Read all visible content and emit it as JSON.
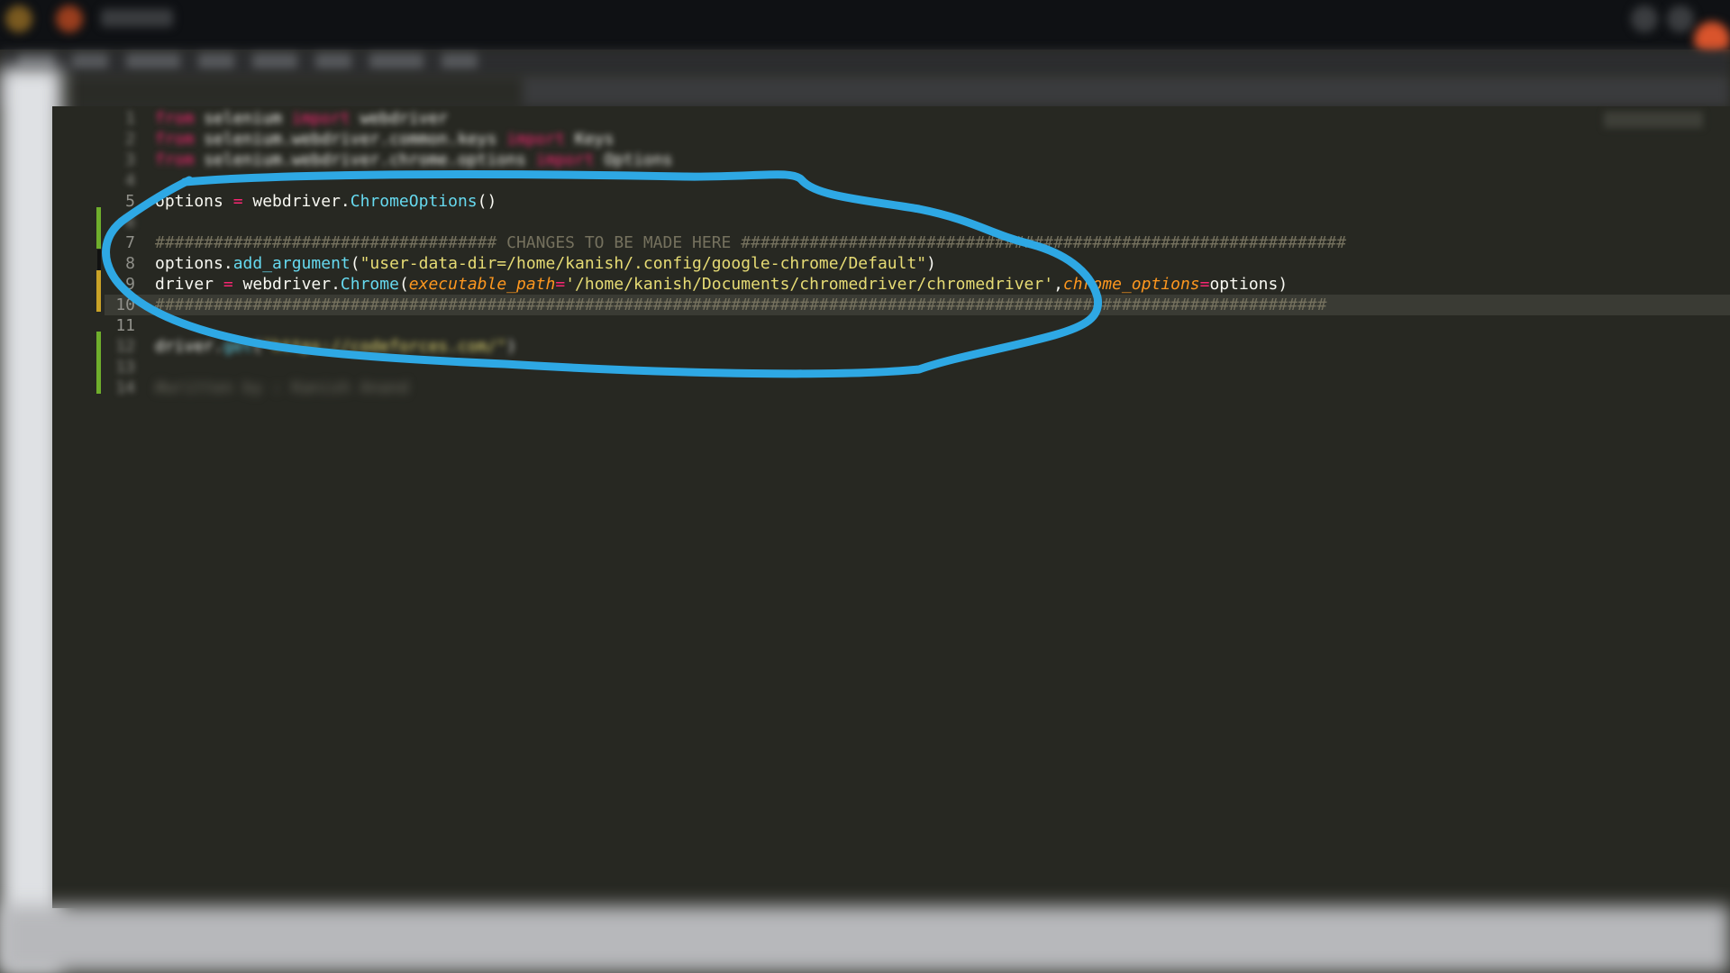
{
  "window": {
    "title": ""
  },
  "editor": {
    "current_line": "10",
    "lines": [
      {
        "num": "1",
        "tokens": [
          {
            "t": "from",
            "c": "kw"
          },
          {
            "t": " selenium ",
            "c": "txt"
          },
          {
            "t": "import",
            "c": "kw"
          },
          {
            "t": " webdriver",
            "c": "txt"
          }
        ]
      },
      {
        "num": "2",
        "tokens": [
          {
            "t": "from",
            "c": "kw"
          },
          {
            "t": " selenium.webdriver.common.keys ",
            "c": "txt"
          },
          {
            "t": "import",
            "c": "kw"
          },
          {
            "t": " Keys",
            "c": "txt"
          }
        ]
      },
      {
        "num": "3",
        "tokens": [
          {
            "t": "from",
            "c": "kw"
          },
          {
            "t": " selenium.webdriver.chrome.options ",
            "c": "txt"
          },
          {
            "t": "import",
            "c": "kw"
          },
          {
            "t": " Options",
            "c": "txt"
          }
        ]
      },
      {
        "num": "4",
        "tokens": []
      },
      {
        "num": "5",
        "tokens": [
          {
            "t": "options",
            "c": "txt"
          },
          {
            "t": " = ",
            "c": "op"
          },
          {
            "t": "webdriver.",
            "c": "txt"
          },
          {
            "t": "ChromeOptions",
            "c": "fn"
          },
          {
            "t": "()",
            "c": "txt"
          }
        ]
      },
      {
        "num": "6",
        "tokens": []
      },
      {
        "num": "7",
        "tokens": [
          {
            "t": "################################### CHANGES TO BE MADE HERE ##############################################################",
            "c": "cmt"
          }
        ]
      },
      {
        "num": "8",
        "tokens": [
          {
            "t": "options.",
            "c": "txt"
          },
          {
            "t": "add_argument",
            "c": "fn"
          },
          {
            "t": "(",
            "c": "txt"
          },
          {
            "t": "\"user-data-dir=/home/kanish/.config/google-chrome/Default\"",
            "c": "str"
          },
          {
            "t": ")",
            "c": "txt"
          }
        ]
      },
      {
        "num": "9",
        "tokens": [
          {
            "t": "driver",
            "c": "txt"
          },
          {
            "t": " = ",
            "c": "op"
          },
          {
            "t": "webdriver.",
            "c": "txt"
          },
          {
            "t": "Chrome",
            "c": "fn"
          },
          {
            "t": "(",
            "c": "txt"
          },
          {
            "t": "executable_path",
            "c": "param"
          },
          {
            "t": "=",
            "c": "op"
          },
          {
            "t": "'/home/kanish/Documents/chromedriver/chromedriver'",
            "c": "str"
          },
          {
            "t": ",",
            "c": "txt"
          },
          {
            "t": "chrome_options",
            "c": "param"
          },
          {
            "t": "=",
            "c": "op"
          },
          {
            "t": "options)",
            "c": "txt"
          }
        ]
      },
      {
        "num": "10",
        "tokens": [
          {
            "t": "########################################################################################################################",
            "c": "cmt"
          }
        ]
      },
      {
        "num": "11",
        "tokens": []
      },
      {
        "num": "12",
        "tokens": [
          {
            "t": "driver.",
            "c": "txt"
          },
          {
            "t": "get",
            "c": "fn"
          },
          {
            "t": "(",
            "c": "txt"
          },
          {
            "t": "\"https://codeforces.com/\"",
            "c": "str"
          },
          {
            "t": ")",
            "c": "txt"
          }
        ]
      },
      {
        "num": "13",
        "tokens": []
      },
      {
        "num": "14",
        "tokens": [
          {
            "t": "#written by : Kanish Anand",
            "c": "faint"
          }
        ]
      }
    ]
  },
  "colors": {
    "annotation_stroke": "#2ea8e4",
    "editor_bg": "#272822",
    "keyword": "#f92672",
    "function": "#66d9ef",
    "string": "#e6db74",
    "parameter": "#fd971f",
    "comment": "#75715e"
  }
}
